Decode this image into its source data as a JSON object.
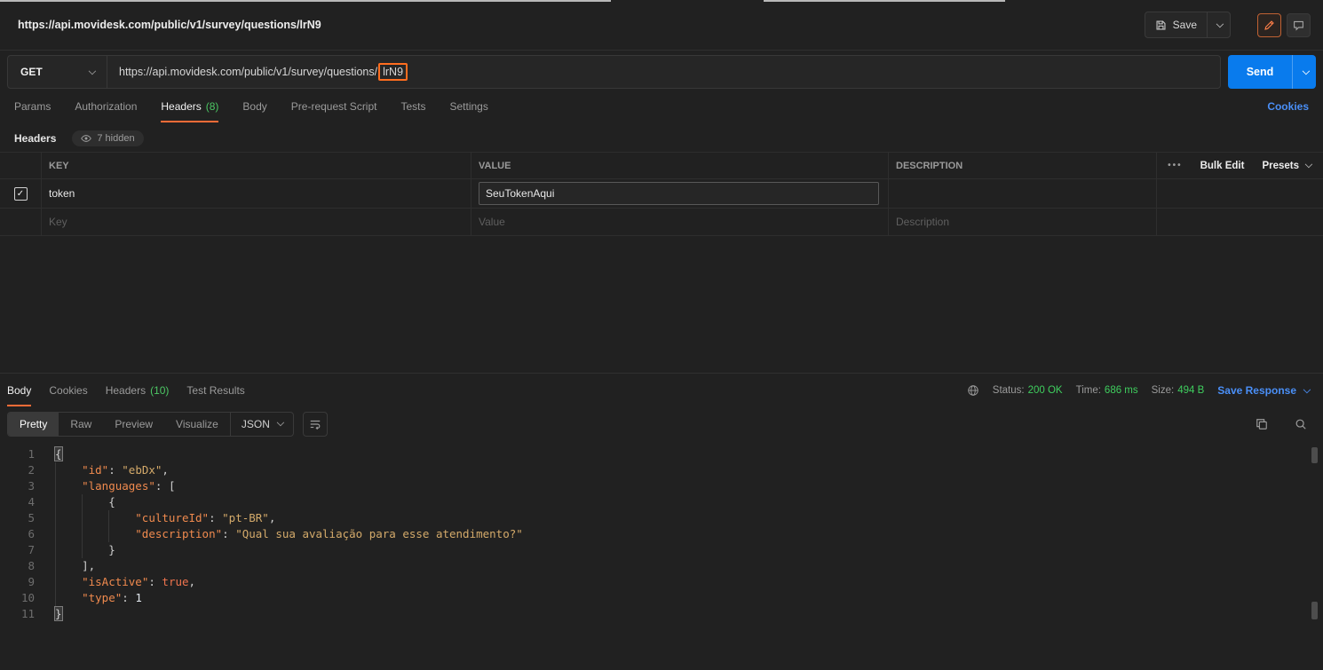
{
  "topbar": {
    "title": "https://api.movidesk.com/public/v1/survey/questions/lrN9",
    "save": "Save"
  },
  "request": {
    "method": "GET",
    "url_prefix": "https://api.movidesk.com/public/v1/survey/questions/",
    "url_highlight": "lrN9",
    "send": "Send"
  },
  "tabs": {
    "params": "Params",
    "authorization": "Authorization",
    "headers": "Headers",
    "headers_count": "(8)",
    "body": "Body",
    "prerequest": "Pre-request Script",
    "tests": "Tests",
    "settings": "Settings",
    "cookies": "Cookies"
  },
  "headers_editor": {
    "title": "Headers",
    "hidden_count": "7 hidden",
    "columns": {
      "key": "KEY",
      "value": "VALUE",
      "description": "DESCRIPTION"
    },
    "bulk_edit": "Bulk Edit",
    "presets": "Presets",
    "row1": {
      "key": "token",
      "value": "SeuTokenAqui"
    },
    "placeholders": {
      "key": "Key",
      "value": "Value",
      "description": "Description"
    }
  },
  "response": {
    "tabs": {
      "body": "Body",
      "cookies": "Cookies",
      "headers": "Headers",
      "headers_count": "(10)",
      "test_results": "Test Results"
    },
    "meta": {
      "status_label": "Status:",
      "status": "200 OK",
      "time_label": "Time:",
      "time": "686 ms",
      "size_label": "Size:",
      "size": "494 B",
      "save_response": "Save Response"
    },
    "views": {
      "pretty": "Pretty",
      "raw": "Raw",
      "preview": "Preview",
      "visualize": "Visualize",
      "format": "JSON"
    }
  },
  "code": {
    "lines": [
      {
        "n": 1,
        "ind": 0,
        "tok": [
          {
            "c": "punct",
            "t": "{",
            "box": true
          }
        ]
      },
      {
        "n": 2,
        "ind": 1,
        "tok": [
          {
            "c": "key",
            "t": "\"id\""
          },
          {
            "c": "punct",
            "t": ": "
          },
          {
            "c": "str",
            "t": "\"ebDx\""
          },
          {
            "c": "punct",
            "t": ","
          }
        ]
      },
      {
        "n": 3,
        "ind": 1,
        "tok": [
          {
            "c": "key",
            "t": "\"languages\""
          },
          {
            "c": "punct",
            "t": ": ["
          }
        ]
      },
      {
        "n": 4,
        "ind": 2,
        "tok": [
          {
            "c": "punct",
            "t": "{"
          }
        ]
      },
      {
        "n": 5,
        "ind": 3,
        "tok": [
          {
            "c": "key",
            "t": "\"cultureId\""
          },
          {
            "c": "punct",
            "t": ": "
          },
          {
            "c": "str",
            "t": "\"pt-BR\""
          },
          {
            "c": "punct",
            "t": ","
          }
        ]
      },
      {
        "n": 6,
        "ind": 3,
        "tok": [
          {
            "c": "key",
            "t": "\"description\""
          },
          {
            "c": "punct",
            "t": ": "
          },
          {
            "c": "str",
            "t": "\"Qual sua avaliação para esse atendimento?\""
          }
        ]
      },
      {
        "n": 7,
        "ind": 2,
        "tok": [
          {
            "c": "punct",
            "t": "}"
          }
        ]
      },
      {
        "n": 8,
        "ind": 1,
        "tok": [
          {
            "c": "punct",
            "t": "],"
          }
        ]
      },
      {
        "n": 9,
        "ind": 1,
        "tok": [
          {
            "c": "key",
            "t": "\"isActive\""
          },
          {
            "c": "punct",
            "t": ": "
          },
          {
            "c": "bool",
            "t": "true"
          },
          {
            "c": "punct",
            "t": ","
          }
        ]
      },
      {
        "n": 10,
        "ind": 1,
        "tok": [
          {
            "c": "key",
            "t": "\"type\""
          },
          {
            "c": "punct",
            "t": ": "
          },
          {
            "c": "num",
            "t": "1"
          }
        ]
      },
      {
        "n": 11,
        "ind": 0,
        "tok": [
          {
            "c": "punct",
            "t": "}",
            "box": true
          }
        ]
      }
    ]
  }
}
